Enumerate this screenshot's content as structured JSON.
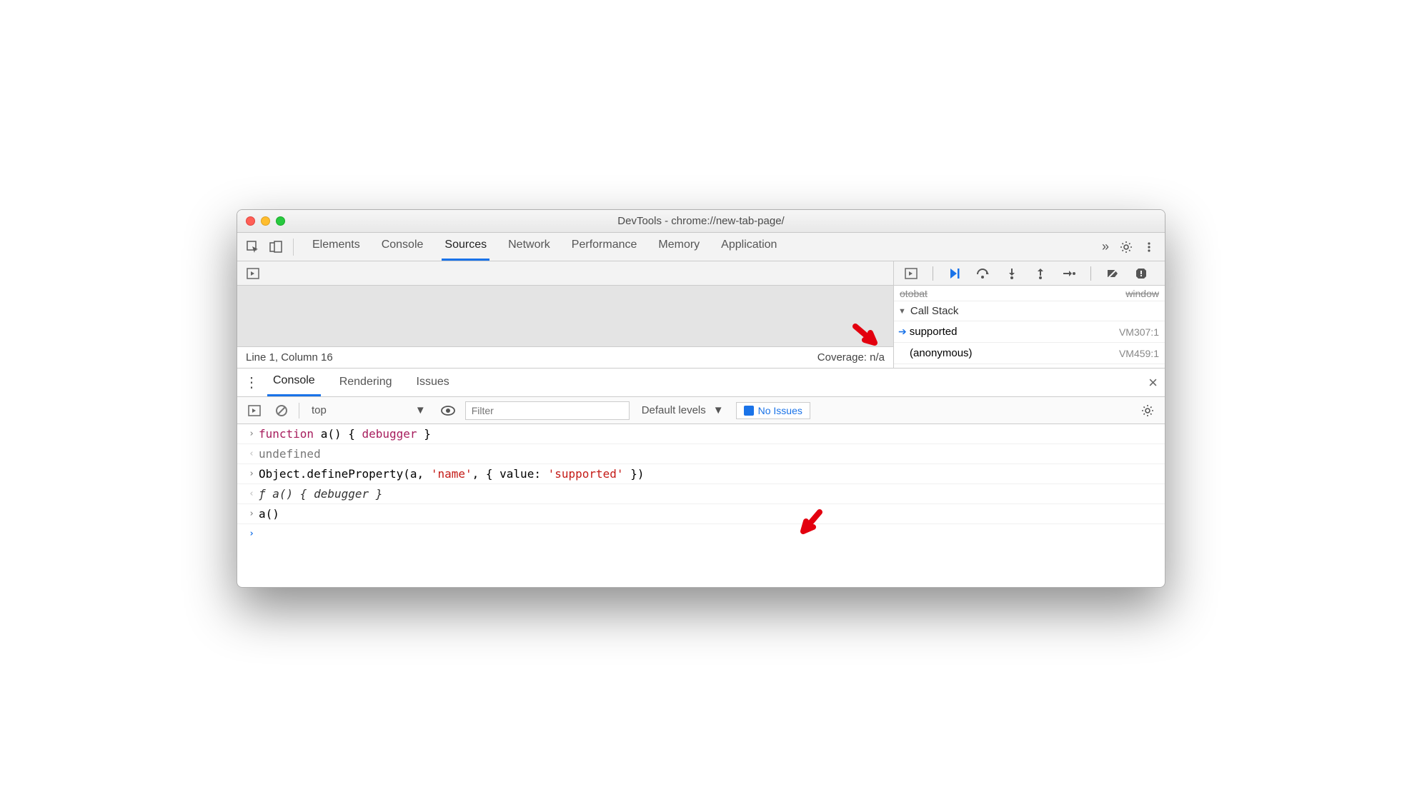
{
  "title": "DevTools - chrome://new-tab-page/",
  "mainTabs": {
    "items": [
      "Elements",
      "Console",
      "Sources",
      "Network",
      "Performance",
      "Memory",
      "Application"
    ],
    "activeIndex": 2
  },
  "sources": {
    "statusLeft": "Line 1, Column 16",
    "statusRight": "Coverage: n/a"
  },
  "callStack": {
    "header": "Call Stack",
    "frames": [
      {
        "name": "supported",
        "loc": "VM307:1",
        "active": true
      },
      {
        "name": "(anonymous)",
        "loc": "VM459:1",
        "active": false
      }
    ]
  },
  "drawer": {
    "tabs": [
      "Console",
      "Rendering",
      "Issues"
    ],
    "activeIndex": 0
  },
  "consoleToolbar": {
    "context": "top",
    "filterPlaceholder": "Filter",
    "levels": "Default levels",
    "issues": "No Issues"
  },
  "consoleLines": {
    "l0_kw1": "function",
    "l0_mid": " a() { ",
    "l0_kw2": "debugger",
    "l0_end": " }",
    "l1": "undefined",
    "l2_pre": "Object.defineProperty(a, ",
    "l2_s1": "'name'",
    "l2_mid": ", { value: ",
    "l2_s2": "'supported'",
    "l2_end": " })",
    "l3_f": "ƒ",
    "l3_rest": " a() { debugger }",
    "l4": "a()"
  }
}
